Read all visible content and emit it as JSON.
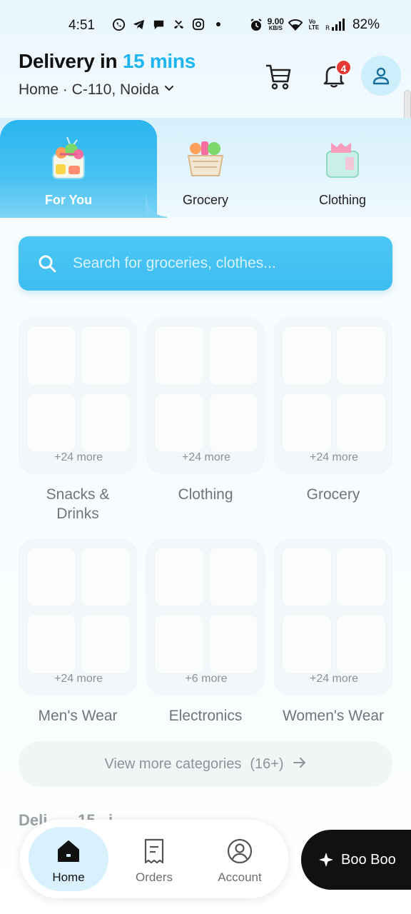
{
  "status_bar": {
    "time": "4:51",
    "net_speed_value": "9.00",
    "net_speed_unit": "KB/S",
    "battery": "82%"
  },
  "header": {
    "delivery_prefix": "Delivery in ",
    "delivery_time": "15 mins",
    "address": "Home · C-110, Noida",
    "notification_count": "4",
    "accent_color": "#1fb5f0"
  },
  "tabs": [
    {
      "label": "For You",
      "icon": "gift-box-icon",
      "active": true
    },
    {
      "label": "Grocery",
      "icon": "grocery-basket-icon",
      "active": false
    },
    {
      "label": "Clothing",
      "icon": "clothing-bag-icon",
      "active": false
    }
  ],
  "search": {
    "placeholder": "Search for groceries, clothes..."
  },
  "categories": [
    {
      "name": "Snacks & Drinks",
      "more": "+24 more"
    },
    {
      "name": "Clothing",
      "more": "+24 more"
    },
    {
      "name": "Grocery",
      "more": "+24 more"
    },
    {
      "name": "Men's Wear",
      "more": "+24 more"
    },
    {
      "name": "Electronics",
      "more": "+6 more"
    },
    {
      "name": "Women's Wear",
      "more": "+24 more"
    }
  ],
  "view_more": {
    "label": "View more categories",
    "count": "(16+)"
  },
  "section_peek": "Deli... ...15 ..i...",
  "bottom_nav": [
    {
      "label": "Home",
      "icon": "home-icon",
      "active": true
    },
    {
      "label": "Orders",
      "icon": "receipt-icon",
      "active": false
    },
    {
      "label": "Account",
      "icon": "account-icon",
      "active": false
    }
  ],
  "fab": {
    "label": "Boo Boo"
  }
}
